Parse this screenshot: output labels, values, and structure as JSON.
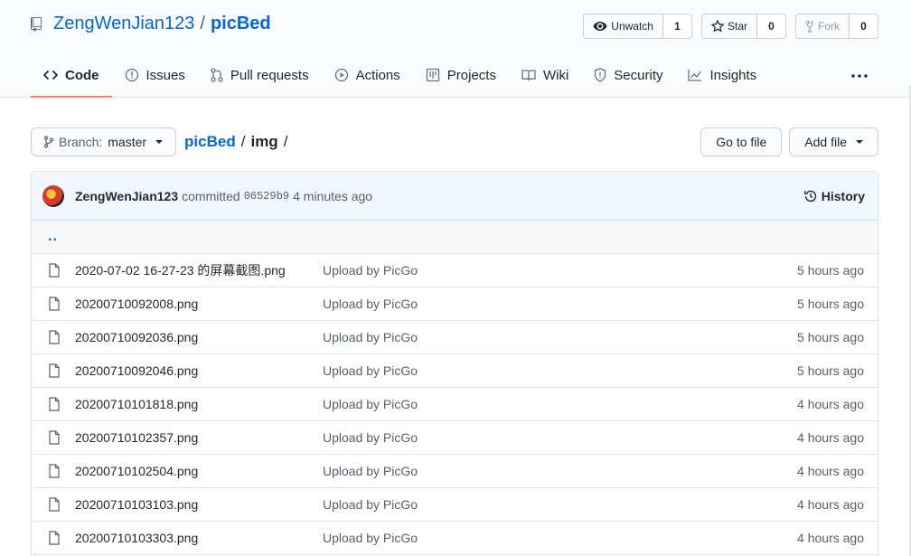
{
  "repo": {
    "owner": "ZengWenJian123",
    "separator": "/",
    "name": "picBed"
  },
  "actions": {
    "watch": {
      "label": "Unwatch",
      "count": "1"
    },
    "star": {
      "label": "Star",
      "count": "0"
    },
    "fork": {
      "label": "Fork",
      "count": "0"
    }
  },
  "nav": {
    "items": [
      {
        "label": "Code",
        "icon": "code-icon",
        "selected": true
      },
      {
        "label": "Issues",
        "icon": "issue-icon"
      },
      {
        "label": "Pull requests",
        "icon": "pull-request-icon"
      },
      {
        "label": "Actions",
        "icon": "play-icon"
      },
      {
        "label": "Projects",
        "icon": "project-icon"
      },
      {
        "label": "Wiki",
        "icon": "book-icon"
      },
      {
        "label": "Security",
        "icon": "shield-icon"
      },
      {
        "label": "Insights",
        "icon": "graph-icon"
      }
    ],
    "more_icon": "kebab-horizontal-icon"
  },
  "file_nav": {
    "branch_prefix": "Branch:",
    "branch": "master",
    "breadcrumb_root": "picBed",
    "breadcrumb_sep": "/",
    "breadcrumb_dir": "img",
    "breadcrumb_trailing": "/",
    "go_to_file": "Go to file",
    "add_file": "Add file"
  },
  "commit": {
    "author": "ZengWenJian123",
    "verb": "committed",
    "sha": "06529b9",
    "time": "4 minutes ago",
    "history": "History"
  },
  "up_link": "..",
  "files": [
    {
      "name": "2020-07-02 16-27-23 的屏幕截图.png",
      "message": "Upload by PicGo",
      "age": "5 hours ago"
    },
    {
      "name": "20200710092008.png",
      "message": "Upload by PicGo",
      "age": "5 hours ago"
    },
    {
      "name": "20200710092036.png",
      "message": "Upload by PicGo",
      "age": "5 hours ago"
    },
    {
      "name": "20200710092046.png",
      "message": "Upload by PicGo",
      "age": "5 hours ago"
    },
    {
      "name": "20200710101818.png",
      "message": "Upload by PicGo",
      "age": "4 hours ago"
    },
    {
      "name": "20200710102357.png",
      "message": "Upload by PicGo",
      "age": "4 hours ago"
    },
    {
      "name": "20200710102504.png",
      "message": "Upload by PicGo",
      "age": "4 hours ago"
    },
    {
      "name": "20200710103103.png",
      "message": "Upload by PicGo",
      "age": "4 hours ago"
    },
    {
      "name": "20200710103303.png",
      "message": "Upload by PicGo",
      "age": "4 hours ago"
    }
  ],
  "colors": {
    "link": "#0366d6",
    "selected_tab_underline": "#f9826c",
    "commit_bar_bg": "#f1f8ff",
    "muted_text": "#586069"
  }
}
